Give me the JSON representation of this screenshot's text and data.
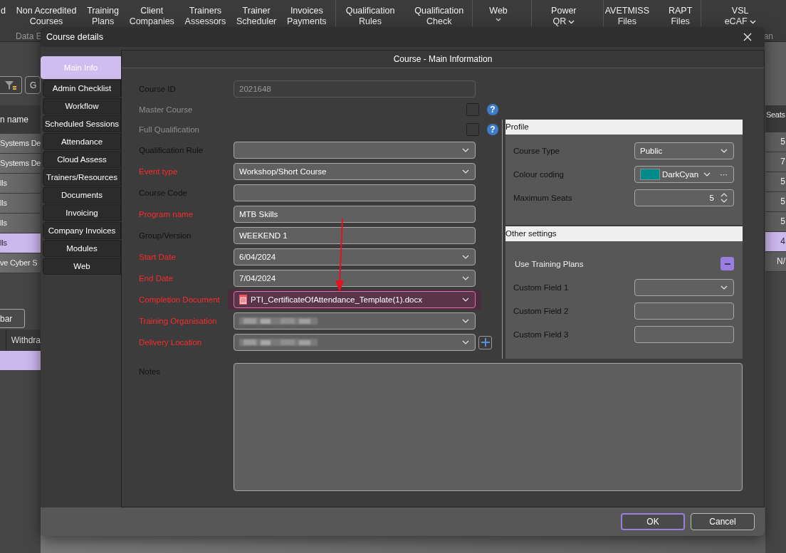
{
  "ribbon": {
    "groups": [
      [
        {
          "lines": [
            "d"
          ],
          "caret": false
        },
        {
          "lines": [
            "Non Accredited",
            "Courses"
          ],
          "caret": false
        },
        {
          "lines": [
            "Training",
            "Plans"
          ],
          "caret": false
        },
        {
          "lines": [
            "Client",
            "Companies"
          ],
          "caret": false
        },
        {
          "lines": [
            "Trainers",
            "Assessors"
          ],
          "caret": false
        },
        {
          "lines": [
            "Trainer",
            "Scheduler"
          ],
          "caret": false
        },
        {
          "lines": [
            "Invoices",
            "Payments"
          ],
          "caret": false
        }
      ],
      [
        {
          "lines": [
            "Qualification",
            "Rules"
          ],
          "caret": false
        },
        {
          "lines": [
            "Qualification",
            "Check"
          ],
          "caret": false
        }
      ],
      [
        {
          "lines": [
            "Web"
          ],
          "caret": true
        }
      ],
      [
        {
          "lines": [
            "Power",
            "QR"
          ],
          "caret": true
        }
      ],
      [
        {
          "lines": [
            "AVETMISS",
            "Files"
          ],
          "caret": false
        },
        {
          "lines": [
            "RAPT",
            "Files"
          ],
          "caret": false
        }
      ],
      [
        {
          "lines": [
            "VSL",
            "eCAF"
          ],
          "caret": true
        }
      ]
    ],
    "group_labels": [
      "Data E",
      "an"
    ]
  },
  "background": {
    "side_button": "G",
    "name_header": "n name",
    "seats_header": "Seats",
    "rows": [
      {
        "name": "Systems De",
        "seats": "5",
        "selected": false
      },
      {
        "name": "Systems De",
        "seats": "7",
        "selected": false
      },
      {
        "name": "lls",
        "seats": "5",
        "selected": false
      },
      {
        "name": "lls",
        "seats": "5",
        "selected": false
      },
      {
        "name": "lls",
        "seats": "5",
        "selected": false
      },
      {
        "name": "lls",
        "seats": "4",
        "selected": true
      },
      {
        "name": "ve Cyber S",
        "seats": "N/",
        "selected": false
      }
    ],
    "lower_button": "bar",
    "lower_header": "Withdra"
  },
  "dialog": {
    "title": "Course details",
    "tabs": [
      {
        "label": "Main Info",
        "selected": true
      },
      {
        "label": "Admin Checklist",
        "selected": false
      },
      {
        "label": "Workflow",
        "selected": false
      },
      {
        "label": "Scheduled Sessions",
        "selected": false
      },
      {
        "label": "Attendance",
        "selected": false
      },
      {
        "label": "Cloud Assess",
        "selected": false
      },
      {
        "label": "Trainers/Resources",
        "selected": false
      },
      {
        "label": "Documents",
        "selected": false
      },
      {
        "label": "Invoicing",
        "selected": false
      },
      {
        "label": "Company Invoices",
        "selected": false
      },
      {
        "label": "Modules",
        "selected": false
      },
      {
        "label": "Web",
        "selected": false
      }
    ],
    "panel_title": "Course - Main Information",
    "form": [
      {
        "label": "Course ID",
        "required": false,
        "disabled": false,
        "kind": "readonly",
        "value": "2021648"
      },
      {
        "label": "Master Course",
        "required": false,
        "disabled": true,
        "kind": "check",
        "checked": false,
        "help_mark": "?"
      },
      {
        "label": "Full Qualification",
        "required": false,
        "disabled": true,
        "kind": "check",
        "checked": false,
        "help_mark": "?"
      },
      {
        "label": "Qualification Rule",
        "required": false,
        "disabled": false,
        "kind": "combo"
      },
      {
        "label": "Event type",
        "required": true,
        "disabled": false,
        "kind": "combo",
        "value": "Workshop/Short Course"
      },
      {
        "label": "Course Code",
        "required": false,
        "disabled": false,
        "kind": "text"
      },
      {
        "label": "Program name",
        "required": true,
        "disabled": false,
        "kind": "text",
        "value": "MTB Skills"
      },
      {
        "label": "Group/Version",
        "required": false,
        "disabled": false,
        "kind": "text",
        "value": "WEEKEND 1"
      },
      {
        "label": "Start Date",
        "required": true,
        "disabled": false,
        "kind": "combo",
        "value": "6/04/2024"
      },
      {
        "label": "End Date",
        "required": true,
        "disabled": false,
        "kind": "combo",
        "value": "7/04/2024"
      },
      {
        "label": "Completion Document",
        "required": true,
        "disabled": false,
        "kind": "combo",
        "value": "PTI_CertificateOfAttendance_Template(1).docx",
        "highlighted": true,
        "file_icon": true
      },
      {
        "label": "Training Organisation",
        "required": true,
        "disabled": false,
        "kind": "combo",
        "redacted": true
      },
      {
        "label": "Delivery Location",
        "required": true,
        "disabled": false,
        "kind": "combo",
        "redacted": true,
        "add_button": true
      }
    ],
    "notes_label": "Notes",
    "groups": [
      {
        "title": "Profile",
        "rows": [
          {
            "label": "Course Type",
            "kind": "combo",
            "value": "Public"
          },
          {
            "label": "Colour coding",
            "kind": "colour",
            "value": "DarkCyan",
            "color": "#008b8b",
            "more": "···"
          },
          {
            "label": "Maximum Seats",
            "kind": "spin",
            "value": "5"
          }
        ]
      },
      {
        "title": "Other settings",
        "rows": [
          {
            "label": "Use Training Plans",
            "kind": "check",
            "indeterminate": true
          },
          {
            "label": "Custom Field 1",
            "kind": "combo"
          },
          {
            "label": "Custom Field 2",
            "kind": "text"
          },
          {
            "label": "Custom Field 3",
            "kind": "text"
          }
        ]
      }
    ],
    "buttons": [
      {
        "label": "OK",
        "default": true
      },
      {
        "label": "Cancel",
        "default": false
      }
    ]
  }
}
